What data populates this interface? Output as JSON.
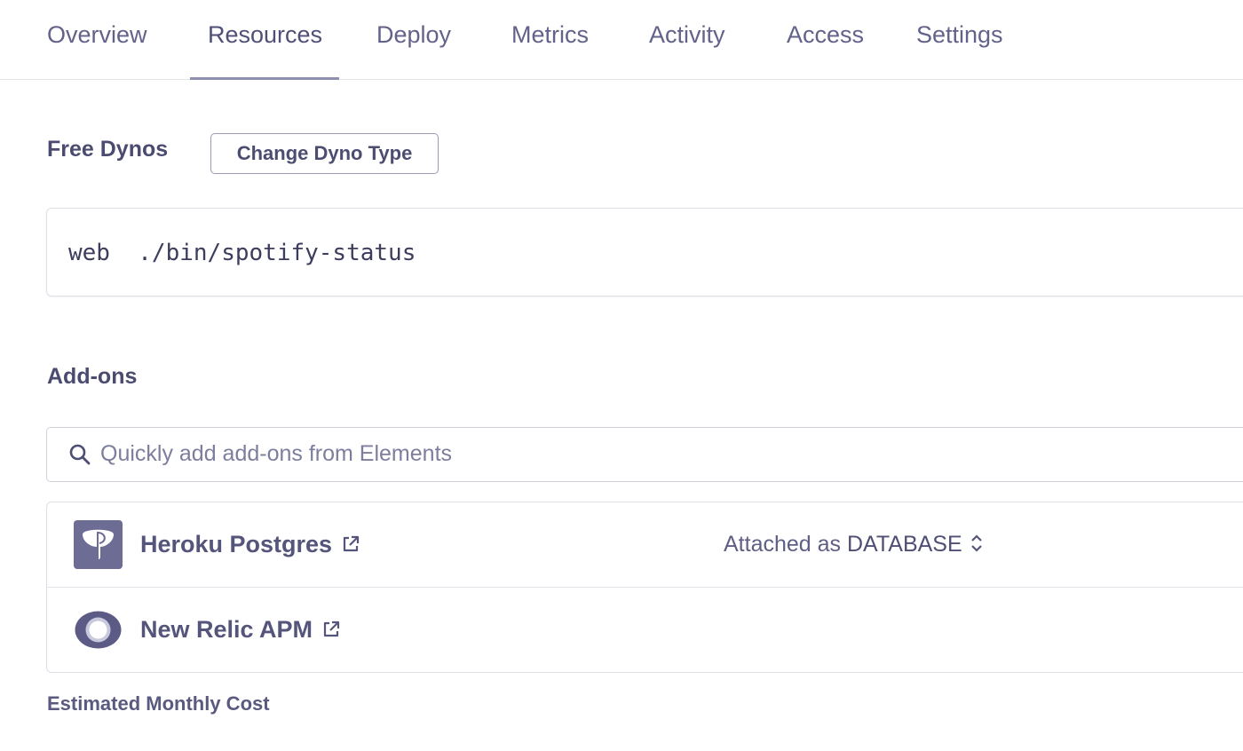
{
  "nav": {
    "tabs": [
      {
        "label": "Overview"
      },
      {
        "label": "Resources"
      },
      {
        "label": "Deploy"
      },
      {
        "label": "Metrics"
      },
      {
        "label": "Activity"
      },
      {
        "label": "Access"
      },
      {
        "label": "Settings"
      }
    ],
    "active_tab": "Resources"
  },
  "dynos": {
    "title": "Free Dynos",
    "change_button_label": "Change Dyno Type",
    "process": {
      "type": "web",
      "command": "./bin/spotify-status"
    }
  },
  "addons": {
    "title": "Add-ons",
    "search_placeholder": "Quickly add add-ons from Elements",
    "items": [
      {
        "name": "Heroku Postgres",
        "attached_prefix": "Attached as",
        "attached_name": "DATABASE",
        "icon": "postgres-icon"
      },
      {
        "name": "New Relic APM",
        "icon": "new-relic-icon"
      }
    ]
  },
  "cost": {
    "label": "Estimated Monthly Cost"
  },
  "colors": {
    "text_primary": "#4b4b70",
    "text_muted": "#62628a",
    "border": "#dedee7",
    "accent": "#8f8fb0"
  }
}
